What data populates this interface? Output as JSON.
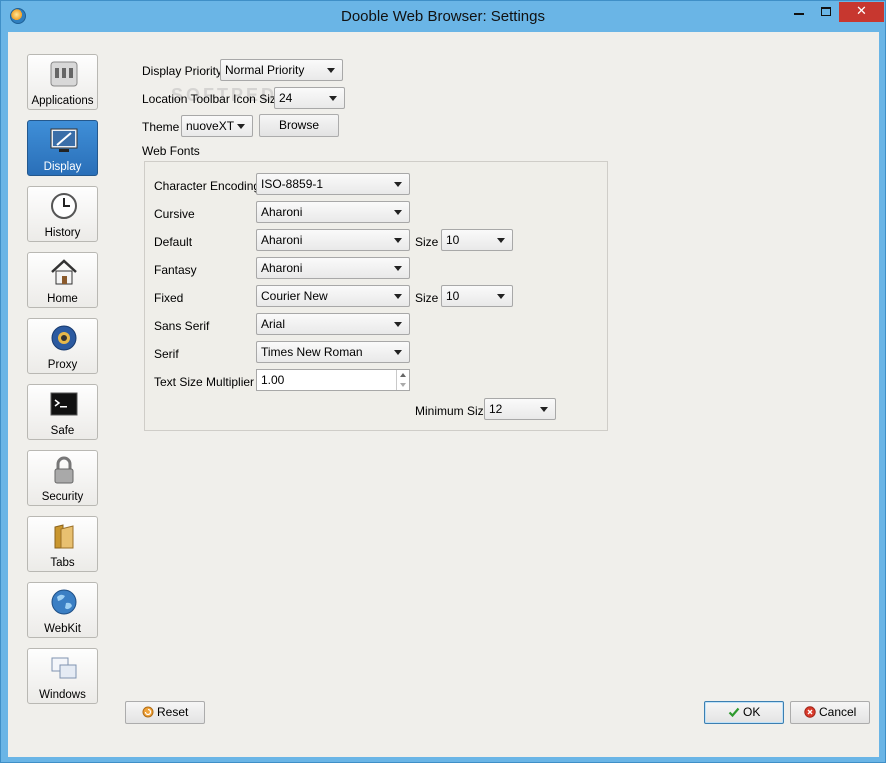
{
  "window": {
    "title": "Dooble Web Browser: Settings",
    "close_glyph": "✕"
  },
  "watermark": "SOFTPEDIA",
  "sidebar": {
    "items": [
      {
        "label": "Applications",
        "icon": "applications-icon"
      },
      {
        "label": "Display",
        "icon": "display-icon",
        "selected": true
      },
      {
        "label": "History",
        "icon": "clock-icon"
      },
      {
        "label": "Home",
        "icon": "house-icon"
      },
      {
        "label": "Proxy",
        "icon": "proxy-icon"
      },
      {
        "label": "Safe",
        "icon": "terminal-icon"
      },
      {
        "label": "Security",
        "icon": "lock-icon"
      },
      {
        "label": "Tabs",
        "icon": "folder-icon"
      },
      {
        "label": "WebKit",
        "icon": "globe-icon"
      },
      {
        "label": "Windows",
        "icon": "windows-icon"
      }
    ]
  },
  "display": {
    "priority_label": "Display Priority",
    "priority_value": "Normal Priority",
    "icon_size_label": "Location Toolbar Icon Size",
    "icon_size_value": "24",
    "theme_label": "Theme",
    "theme_value": "nuoveXT",
    "browse_label": "Browse",
    "web_fonts_label": "Web Fonts"
  },
  "fonts": {
    "encoding_label": "Character Encoding",
    "encoding_value": "ISO-8859-1",
    "cursive_label": "Cursive",
    "cursive_value": "Aharoni",
    "default_label": "Default",
    "default_value": "Aharoni",
    "default_size_label": "Size",
    "default_size_value": "10",
    "fantasy_label": "Fantasy",
    "fantasy_value": "Aharoni",
    "fixed_label": "Fixed",
    "fixed_value": "Courier New",
    "fixed_size_label": "Size",
    "fixed_size_value": "10",
    "sans_label": "Sans Serif",
    "sans_value": "Arial",
    "serif_label": "Serif",
    "serif_value": "Times New Roman",
    "multiplier_label": "Text Size Multiplier",
    "multiplier_value": "1.00",
    "min_size_label": "Minimum Size",
    "min_size_value": "12"
  },
  "footer": {
    "reset_label": "Reset",
    "ok_label": "OK",
    "cancel_label": "Cancel"
  }
}
